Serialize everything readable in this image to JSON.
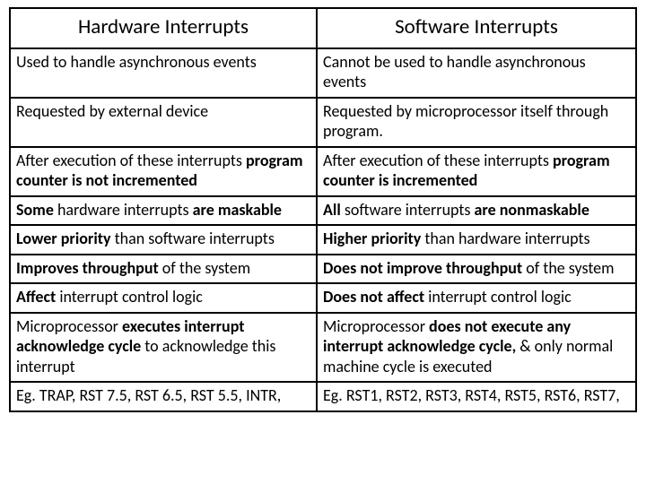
{
  "table": {
    "headers": [
      "Hardware Interrupts",
      "Software Interrupts"
    ],
    "rows": [
      {
        "hw": "Used to handle asynchronous events",
        "sw": "Cannot be used to handle asynchronous events"
      },
      {
        "hw": "Requested by external device",
        "sw": "Requested by microprocessor itself through program."
      },
      {
        "hw": "After execution of these interrupts <b>program counter is not incremented</b>",
        "sw": "After execution of these interrupts <b>program counter is incremented</b>"
      },
      {
        "hw": "<b>Some</b> hardware interrupts <b>are maskable</b>",
        "sw": "<b>All</b> software interrupts <b>are nonmaskable</b>"
      },
      {
        "hw": "<b>Lower priority</b> than software interrupts",
        "sw": "<b>Higher priority</b> than hardware interrupts"
      },
      {
        "hw": "<b>Improves throughput</b> of the system",
        "sw": "<b>Does not improve throughput</b> of the system"
      },
      {
        "hw": "<b>Affect</b> interrupt control logic",
        "sw": "<b>Does not affect</b> interrupt control logic"
      },
      {
        "hw": "Microprocessor <b>executes interrupt acknowledge cycle</b> to acknowledge this interrupt",
        "sw": "Microprocessor <b>does not execute any interrupt acknowledge cycle,</b> & only normal machine cycle is executed"
      },
      {
        "hw": "Eg. TRAP, RST 7.5, RST 6.5, RST 5.5, INTR,",
        "sw": "Eg. RST1, RST2, RST3, RST4, RST5, RST6, RST7,"
      }
    ]
  }
}
